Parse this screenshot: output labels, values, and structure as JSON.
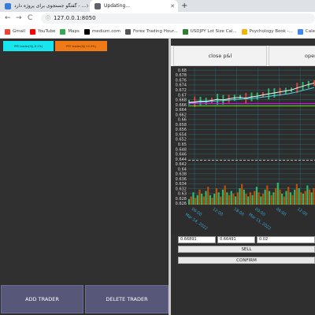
{
  "browser": {
    "tabs": [
      {
        "title": "گفتگو جستجوی برای پروژه دارد - ..."
      },
      {
        "title": "Updating..."
      }
    ],
    "new_tab": "+",
    "address": "127.0.0.1:8050",
    "nav": {
      "back": "←",
      "forward": "→",
      "reload": "C"
    },
    "bookmarks": [
      {
        "label": "Gmail",
        "color": "#ea4335"
      },
      {
        "label": "YouTube",
        "color": "#ff0000"
      },
      {
        "label": "Maps",
        "color": "#34a853"
      },
      {
        "label": "medium.com",
        "color": "#000000"
      },
      {
        "label": "Forex Trading Hour...",
        "color": "#555555"
      },
      {
        "label": "USDJPY Lot Size Cal...",
        "color": "#2e7d32"
      },
      {
        "label": "Psychology Book -...",
        "color": "#f4b400"
      },
      {
        "label": "Calend",
        "color": "#4285f4"
      }
    ]
  },
  "left_panel": {
    "traders": [
      {
        "label": "PFE trader(0)(-0.1%)",
        "color": "#18e6ee"
      },
      {
        "label": "PFE trader(0)(+0.5%)",
        "color": "#f07a18"
      }
    ],
    "add_trader_label": "ADD TRADER",
    "delete_trader_label": "DELETE TRADER"
  },
  "right_panel": {
    "close_pl_label": "close p&l",
    "open_label": "open",
    "inputs": [
      "0.66891",
      "0.66491",
      "0.02"
    ],
    "sell_label": "SELL",
    "confirm_label": "CONFIRM"
  },
  "chart_data": {
    "type": "line",
    "y_ticks": [
      "0.68",
      "0.678",
      "0.676",
      "0.674",
      "0.672",
      "0.67",
      "0.668",
      "0.666",
      "0.664",
      "0.662",
      "0.66",
      "0.658",
      "0.656",
      "0.654",
      "0.652",
      "0.65",
      "0.648",
      "0.646",
      "0.644",
      "0.642",
      "0.64",
      "0.638",
      "0.636",
      "0.634",
      "0.632",
      "0.63",
      "0.628",
      "0.626"
    ],
    "ylim": [
      0.6255,
      0.681
    ],
    "x_ticks": [
      {
        "time": "06:00",
        "date": "Mar 14, 2022"
      },
      {
        "time": "12:00",
        "date": ""
      },
      {
        "time": "18:00",
        "date": ""
      },
      {
        "time": "00:00",
        "date": "Mar 15, 2022"
      },
      {
        "time": "06:00",
        "date": ""
      },
      {
        "time": "12:00",
        "date": ""
      }
    ],
    "grid": true,
    "colors": {
      "background": "#2d2d2d",
      "grid": "#2a7a82",
      "candle_up": "#2ecc71",
      "candle_down": "#e74c3c",
      "ma_fast": "#ffffff",
      "ma_slow": "#4dd0e1",
      "level_1": "#ff00ff",
      "level_2": "#7cfc00",
      "dashed": "#ffffff",
      "volume": "#d35400"
    },
    "price_line": [
      0.667,
      0.6672,
      0.6675,
      0.6674,
      0.6678,
      0.6682,
      0.668,
      0.6684,
      0.6688,
      0.669,
      0.6687,
      0.6692,
      0.6695,
      0.67,
      0.6704,
      0.6708,
      0.6712,
      0.6716,
      0.672,
      0.6728,
      0.6735,
      0.6742,
      0.6748
    ],
    "slow_line": [
      0.6668,
      0.6669,
      0.6671,
      0.6672,
      0.6674,
      0.6676,
      0.6677,
      0.6679,
      0.6681,
      0.6683,
      0.6684,
      0.6686,
      0.6688,
      0.6691,
      0.6694,
      0.6697,
      0.67,
      0.6703,
      0.6707,
      0.6712,
      0.6718,
      0.6724,
      0.673
    ],
    "levels": [
      0.6665,
      0.6655
    ],
    "dashed_level": 0.6435,
    "volume": [
      4,
      6,
      9,
      5,
      7,
      11,
      8,
      6,
      10,
      13,
      7,
      5,
      8,
      12,
      9,
      6,
      11,
      14,
      9,
      7,
      10,
      8,
      6,
      9,
      12,
      15,
      11,
      8,
      6,
      9,
      7,
      10,
      13,
      9,
      6,
      8,
      11,
      14,
      10,
      7,
      9,
      12,
      16,
      11,
      8,
      6,
      10,
      13,
      9,
      7,
      11,
      15,
      12,
      9,
      8,
      10,
      14,
      11,
      9,
      12
    ]
  }
}
